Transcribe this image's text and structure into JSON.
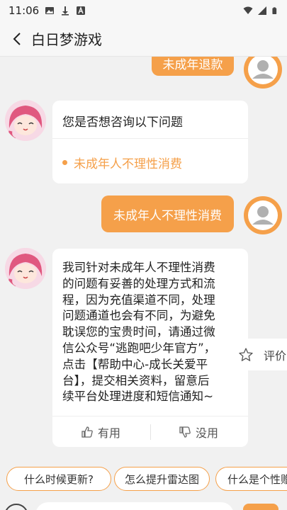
{
  "status_bar": {
    "time": "11:06"
  },
  "header": {
    "title": "白日梦游戏"
  },
  "messages": {
    "user_msg_1": "未成年退款",
    "suggestion": {
      "prompt": "您是否想咨询以下问题",
      "options": [
        "未成年人不理性消费"
      ]
    },
    "user_msg_2": "未成年人不理性消费",
    "reply": {
      "lines": [
        "我司针对未成年人不理性消费",
        "的问题有妥善的处理方式和流",
        "程，因为充值渠道不同，处理",
        "问题通道也会有不同，为避免",
        "耽误您的宝贵时间，请通过微",
        "信公众号“逃跑吧少年官方”，",
        "点击【帮助中心-成长关爱平",
        "台】，提交相关资料，留意后",
        "续平台处理进度和短信通知~"
      ],
      "useful_label": "有用",
      "useless_label": "没用"
    }
  },
  "rate": {
    "label": "评价"
  },
  "quick_chips": [
    "什么时候更新?",
    "怎么提升雷达图",
    "什么是个性赠"
  ],
  "colors": {
    "accent": "#f5a04a",
    "background": "#f1f1f1"
  }
}
